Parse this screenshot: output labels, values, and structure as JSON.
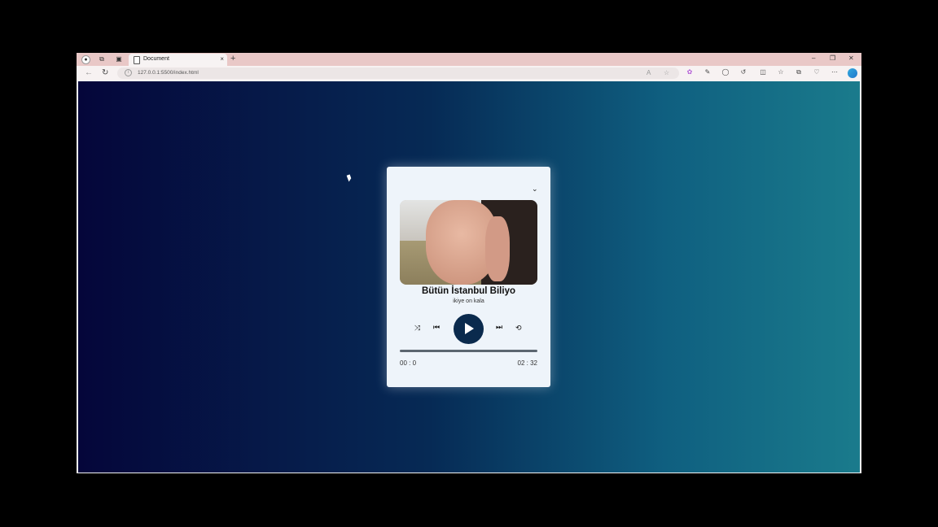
{
  "browser": {
    "tab_title": "Document",
    "url": "127.0.0.1:5500/index.html",
    "new_tab_label": "+",
    "close_tab_label": "×"
  },
  "player": {
    "song_title": "Bütün İstanbul Biliyo",
    "artist": "ikiye on kala",
    "current_time": "00 : 0",
    "duration": "02 : 32",
    "progress": 0
  },
  "colors": {
    "card_bg": "#eef4fa",
    "play_button": "#0a2a4d",
    "bg_start": "#05063a",
    "bg_end": "#1a7b8c"
  }
}
